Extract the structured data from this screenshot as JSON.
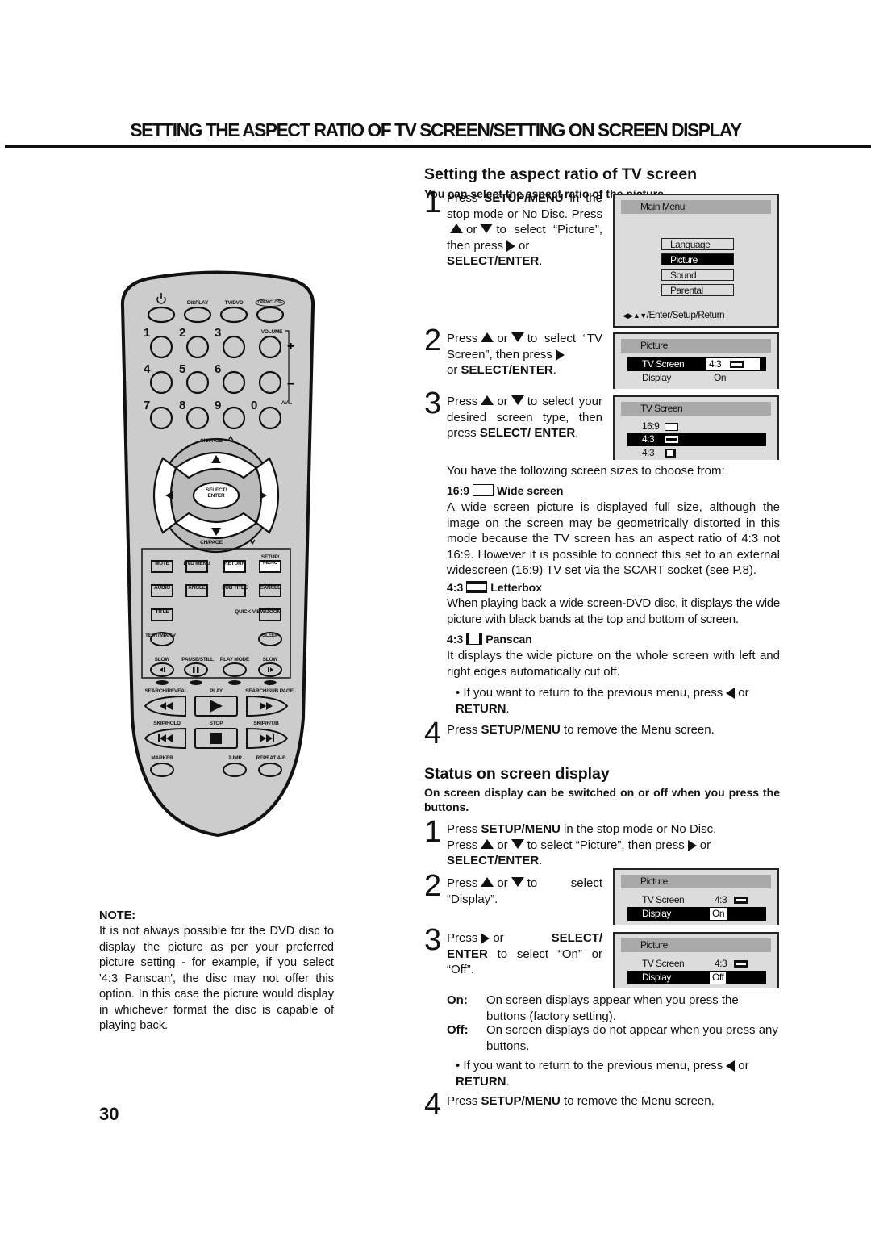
{
  "page": {
    "title": "SETTING THE ASPECT RATIO OF TV SCREEN/SETTING ON SCREEN DISPLAY",
    "page_number": "30"
  },
  "aspect": {
    "heading": "Setting the aspect ratio of TV screen",
    "subheading": "You can select the aspect ratio of the picture.",
    "step1": {
      "num": "1",
      "t1": "Press ",
      "b1": "SETUP/MENU",
      "t2": " in the stop mode or No Disc.",
      "t3": "Press",
      "t4": "or",
      "t5": "to select “Picture”, then press",
      "t6": "or",
      "b2": "SELECT/ENTER",
      "t7": "."
    },
    "step2": {
      "num": "2",
      "t1": "Press",
      "t2": "or",
      "t3": "to select “TV Screen”, then press",
      "t4": "or ",
      "b1": "SELECT/ENTER",
      "t5": "."
    },
    "step3": {
      "num": "3",
      "t1": "Press",
      "t2": "or",
      "t3": "to select your desired screen type, then press ",
      "b1": "SELECT/ ENTER",
      "t4": "."
    },
    "intro": "You have the following screen sizes to choose from:",
    "options": [
      {
        "ratio": "16:9",
        "name": "Wide screen",
        "icon": "widescreen-icon",
        "desc": "A wide screen picture is displayed full size, although the image on the screen may be geometrically distorted in this mode because the TV screen has an aspect ratio of 4:3 not 16:9. However it is possible to connect this set to an external widescreen (16:9) TV set via the SCART socket (see P.8)."
      },
      {
        "ratio": "4:3",
        "name": "Letterbox",
        "icon": "letterbox-icon",
        "desc": "When playing back a wide screen-DVD disc, it displays the wide picture with black bands at the top and bottom of screen."
      },
      {
        "ratio": "4:3",
        "name": "Panscan",
        "icon": "panscan-icon",
        "desc": "It displays the wide picture on the whole screen with left and right edges automatically cut off."
      }
    ],
    "bullet": {
      "t1": "If you want to return to the previous menu, press",
      "t2": "or",
      "b1": "RETURN",
      "t3": "."
    },
    "step4": {
      "num": "4",
      "t1": "Press ",
      "b1": "SETUP/MENU",
      "t2": " to remove the Menu screen."
    }
  },
  "osd": {
    "main_menu": {
      "title": "Main Menu",
      "items": [
        "Language",
        "Picture",
        "Sound",
        "Parental"
      ],
      "selected": "Picture",
      "footer": "/Enter/Setup/Return"
    },
    "picture_menu": {
      "title": "Picture",
      "rows": [
        {
          "label": "TV Screen",
          "value": "4:3"
        },
        {
          "label": "Display",
          "value": "On"
        }
      ]
    },
    "tv_screen_menu": {
      "title": "TV Screen",
      "items": [
        "16:9",
        "4:3",
        "4:3"
      ],
      "selected_index": 1
    },
    "display_on": {
      "title": "Picture",
      "rows": [
        {
          "label": "TV Screen",
          "value": "4:3"
        },
        {
          "label": "Display",
          "value": "On"
        }
      ]
    },
    "display_off": {
      "title": "Picture",
      "rows": [
        {
          "label": "TV Screen",
          "value": "4:3"
        },
        {
          "label": "Display",
          "value": "Off"
        }
      ]
    }
  },
  "status": {
    "heading": "Status on screen display",
    "subheading": "On screen display can be switched on or off when you press the buttons.",
    "step1": {
      "num": "1",
      "t1": "Press ",
      "b1": "SETUP/MENU",
      "t2": " in the stop mode or No Disc.",
      "t3": "Press",
      "t4": "or",
      "t5": "to select  “Picture”, then press",
      "t6": "or",
      "b2": "SELECT/ENTER",
      "t7": "."
    },
    "step2": {
      "num": "2",
      "t1": "Press",
      "t2": "or",
      "t3": "to select “Display”."
    },
    "step3": {
      "num": "3",
      "t1": "Press",
      "t2": "or ",
      "b1": "SELECT/",
      "b2": "ENTER",
      "t3": " to select  “On” or “Off”."
    },
    "on_label": "On:",
    "on_desc": "On screen displays appear when you press the buttons (factory setting).",
    "off_label": "Off:",
    "off_desc": "On screen displays do not appear when you press any buttons.",
    "bullet": {
      "t1": "If you want to return to the previous menu, press",
      "t2": "or",
      "b1": "RETURN",
      "t3": "."
    },
    "step4": {
      "num": "4",
      "t1": "Press ",
      "b1": "SETUP/MENU",
      "t2": " to remove the Menu screen."
    }
  },
  "note": {
    "label": "NOTE:",
    "text": "It is not always possible for the DVD disc to display the picture as per your preferred picture setting - for example, if you select '4:3 Panscan', the disc may not offer this option. In this case the picture would display in whichever format the disc is capable of playing back."
  },
  "remote": {
    "top_labels": {
      "display": "DISPLAY",
      "tvdvd": "TV/DVD",
      "openclose": "OPEN/CLOSE"
    },
    "digits": [
      "1",
      "2",
      "3",
      "4",
      "5",
      "6",
      "7",
      "8",
      "9",
      "0"
    ],
    "volume": "VOLUME",
    "av": "AV",
    "chpage_up": "CH/PAGE",
    "chpage_down": "CH/PAGE",
    "select_enter": "SELECT/ ENTER",
    "panel_labels": [
      "MUTE",
      "DVD MENU",
      "RETURN",
      "SETUP/ MENU",
      "AUDIO",
      "ANGLE",
      "SUB TITLE",
      "CANCEL",
      "TITLE",
      "QUICK VIEW/ZOOM",
      "TEXT/MIX/TV",
      "SLEEP",
      "SLOW",
      "PAUSE/STILL",
      "PLAY MODE",
      "SLOW"
    ],
    "transport_labels": [
      "SEARCH/REVEAL",
      "PLAY",
      "SEARCH/SUB PAGE",
      "SKIP/HOLD",
      "STOP",
      "SKIP/F/T/B",
      "MARKER",
      "JUMP",
      "REPEAT A-B"
    ]
  }
}
